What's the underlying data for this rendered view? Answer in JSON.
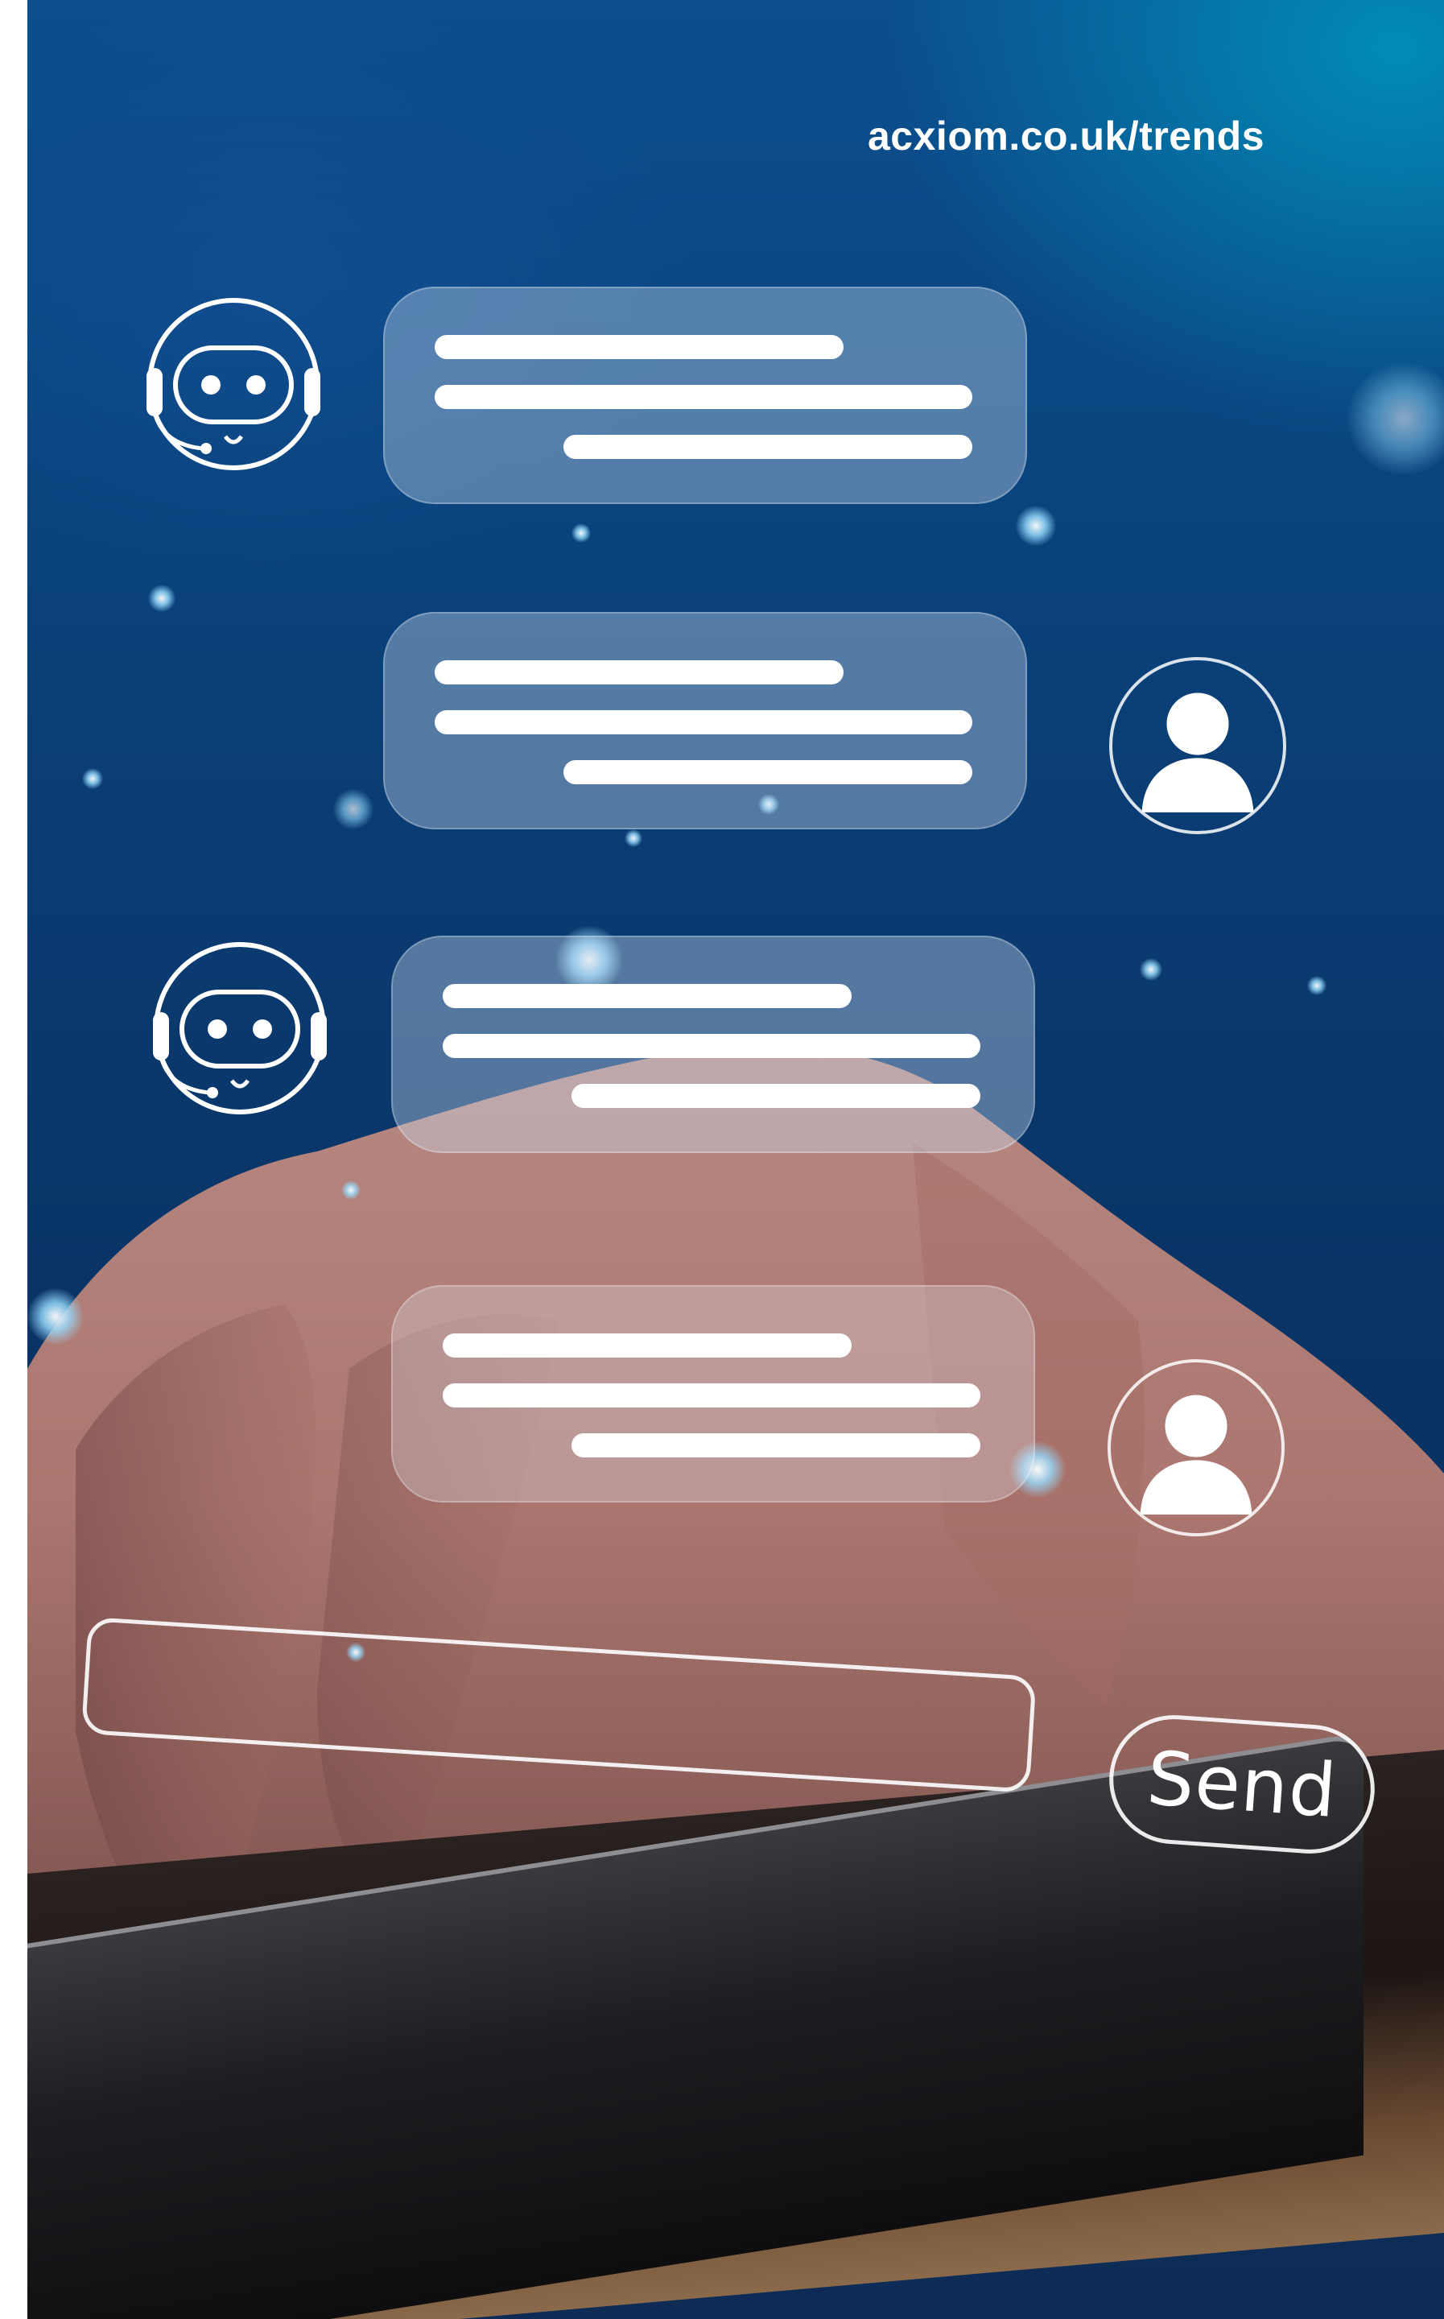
{
  "header": {
    "url": "acxiom.co.uk/trends"
  },
  "chat": {
    "messages": [
      {
        "sender": "bot",
        "icon": "robot-headset-icon"
      },
      {
        "sender": "user",
        "icon": "user-avatar-icon"
      },
      {
        "sender": "bot",
        "icon": "robot-headset-icon"
      },
      {
        "sender": "user",
        "icon": "user-avatar-icon"
      }
    ],
    "input": {
      "value": ""
    },
    "send_label": "Send"
  },
  "colors": {
    "background_top": "#0b4f8e",
    "background_bottom": "#0d2b55",
    "accent_cyan": "#0096be",
    "bubble_fill": "rgba(205,220,240,0.38)",
    "text": "#ffffff"
  }
}
